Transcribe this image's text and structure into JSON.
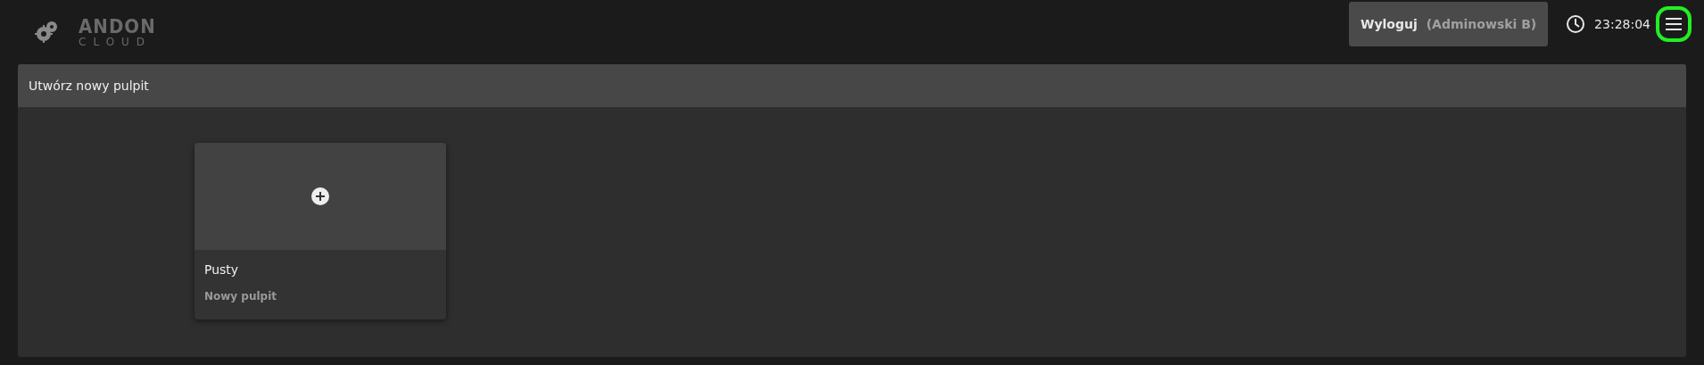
{
  "header": {
    "logo": {
      "top": "ANDON",
      "bottom": "CLOUD"
    },
    "logout_button": {
      "label": "Wyloguj",
      "user": "(Adminowski B)"
    },
    "time": "23:28:04",
    "menu_button": {
      "focused": true
    }
  },
  "panel": {
    "title": "Utwórz nowy pulpit",
    "templates": [
      {
        "title": "Pusty",
        "subtitle": "Nowy pulpit"
      }
    ]
  }
}
